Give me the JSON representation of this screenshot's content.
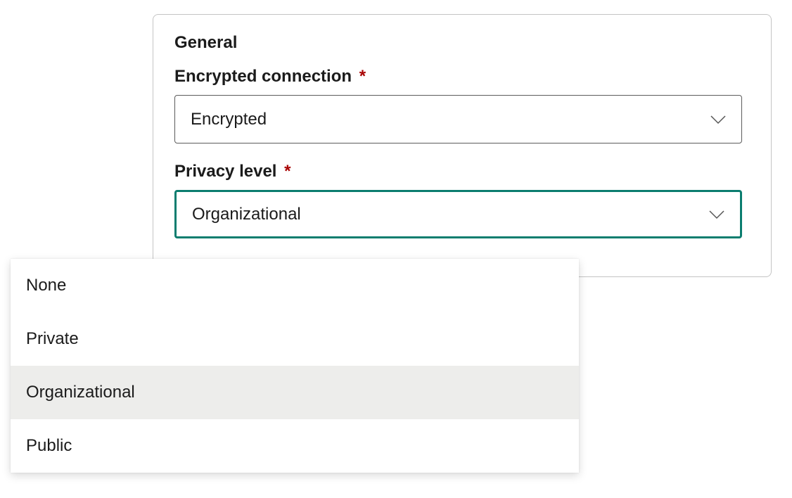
{
  "panel": {
    "section_title": "General",
    "fields": {
      "encrypted": {
        "label": "Encrypted connection",
        "required_marker": "*",
        "value": "Encrypted"
      },
      "privacy": {
        "label": "Privacy level",
        "required_marker": "*",
        "value": "Organizational"
      }
    }
  },
  "dropdown": {
    "options": [
      {
        "label": "None"
      },
      {
        "label": "Private"
      },
      {
        "label": "Organizational"
      },
      {
        "label": "Public"
      }
    ],
    "selected_index": 2
  },
  "colors": {
    "accent": "#0b7d6f",
    "required": "#a80000",
    "border": "#5b5b5b",
    "panel_border": "#c4c4c4",
    "selected_bg": "#ededeb"
  }
}
